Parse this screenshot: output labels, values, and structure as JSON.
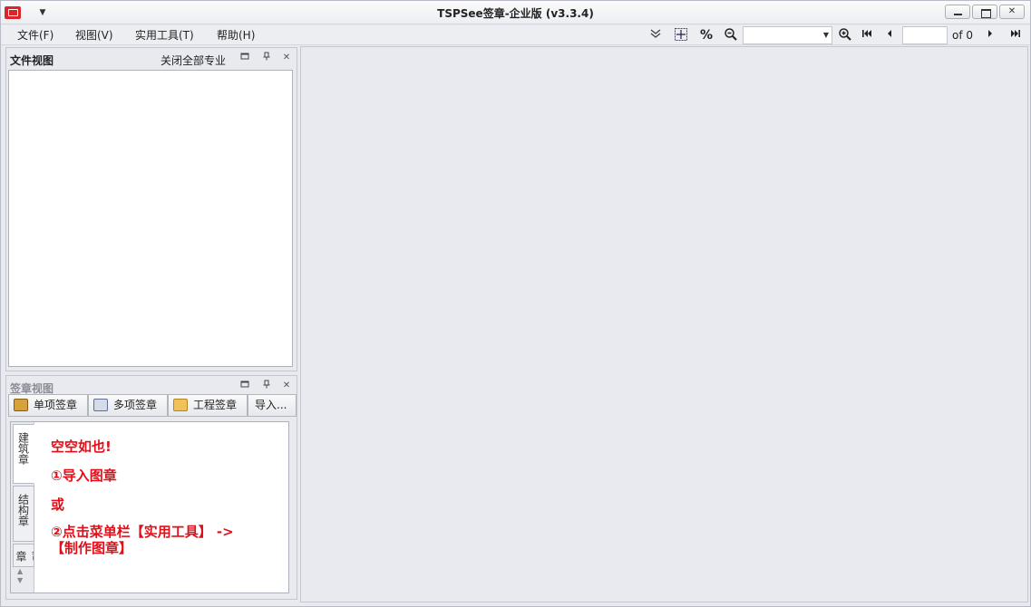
{
  "window": {
    "title": "TSPSee签章-企业版 (v3.3.4)",
    "qat_dropdown_icon": "dropdown-arrow-icon"
  },
  "menu": {
    "items": [
      "文件(F)",
      "视图(V)",
      "实用工具(T)",
      "帮助(H)"
    ]
  },
  "toolbar": {
    "percent_label": "%",
    "zoom_value": "",
    "page_value": "",
    "of_label": "of 0"
  },
  "file_view": {
    "title": "文件视图",
    "close_all_label": "关闭全部专业"
  },
  "stamp_view": {
    "title": "签章视图",
    "tabs": [
      {
        "label": "单项签章",
        "icon": "single-stamp-icon"
      },
      {
        "label": "多项签章",
        "icon": "multi-stamp-icon"
      },
      {
        "label": "工程签章",
        "icon": "folder-icon"
      },
      {
        "label": "导入..."
      }
    ],
    "vertical_tabs": [
      "建筑章",
      "结构章",
      "司章"
    ],
    "empty_message": {
      "line1": "空空如也!",
      "line2": "①导入图章",
      "line3": "或",
      "line4a": "②点击菜单栏【实用工具】 ->",
      "line4b": "【制作图章】"
    }
  },
  "colors": {
    "accent_red": "#e0101a",
    "background": "#e9eaef"
  }
}
